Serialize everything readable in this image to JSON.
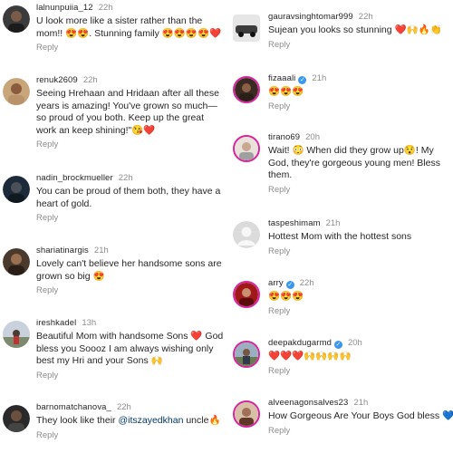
{
  "left_column": [
    {
      "username": "lalnunpuiia_12",
      "time": "22h",
      "verified": false,
      "text": "U look more like a sister rather than the mom!! 😍😍. Stunning family 😍😍😍😍❤️",
      "reply": "Reply",
      "avatar": "dark-portrait"
    },
    {
      "username": "renuk2609",
      "time": "22h",
      "verified": false,
      "text": "Seeing Hrehaan and Hridaan after all these years is amazing! You've grown so much—so proud of you both. Keep up the great work an keep shining!\"😘❤️",
      "reply": "Reply",
      "avatar": "woman-portrait"
    },
    {
      "username": "nadin_brockmueller",
      "time": "22h",
      "verified": false,
      "text": "You can be proud of them both, they have a heart of gold.",
      "reply": "Reply",
      "avatar": "dark-blue-portrait"
    },
    {
      "username": "shariatinargis",
      "time": "21h",
      "verified": false,
      "text": "Lovely can't believe her handsome sons are grown so big 😍",
      "reply": "Reply",
      "avatar": "brown-portrait"
    },
    {
      "username": "ireshkadel",
      "time": "13h",
      "verified": false,
      "text": "Beautiful Mom with handsome Sons ❤️ God bless you Soooz I am always wishing only best my Hri and your Sons 🙌",
      "reply": "Reply",
      "avatar": "outdoor-photo"
    },
    {
      "username": "barnomatchanova_",
      "time": "22h",
      "verified": false,
      "text_pre": "They look like their ",
      "mention": "@itszayedkhan",
      "text_post": " uncle🔥",
      "reply": "Reply",
      "avatar": "dark-portrait-2"
    }
  ],
  "right_column": [
    {
      "username": "gauravsinghtomar999",
      "time": "22h",
      "verified": false,
      "text": "Sujean you looks so stunning ❤️🙌🔥👏",
      "reply": "Reply",
      "avatar": "car-photo"
    },
    {
      "username": "fizaaali",
      "time": "21h",
      "verified": true,
      "text": "😍😍😍",
      "reply": "Reply",
      "avatar": "dark-portrait-3"
    },
    {
      "username": "tirano69",
      "time": "20h",
      "verified": false,
      "text": "Wait! 😳 When did they grow up😯! My God, they're gorgeous young men! Bless them.",
      "reply": "Reply",
      "avatar": "light-portrait"
    },
    {
      "username": "taspeshimam",
      "time": "21h",
      "verified": false,
      "text": "Hottest Mom with the hottest sons",
      "reply": "Reply",
      "avatar": "default-avatar"
    },
    {
      "username": "arry",
      "time": "22h",
      "verified": true,
      "text": "😍😍😍",
      "reply": "Reply",
      "avatar": "red-portrait"
    },
    {
      "username": "deepakdugarmd",
      "time": "20h",
      "verified": true,
      "text": "❤️❤️❤️🙌🙌🙌🙌",
      "reply": "Reply",
      "avatar": "outdoor-portrait"
    },
    {
      "username": "alveenagonsalves23",
      "time": "21h",
      "verified": false,
      "text": "How Gorgeous Are Your Boys God bless 💙🙌",
      "reply": "Reply",
      "avatar": "woman-portrait-2"
    }
  ],
  "colors": {
    "text": "#262626",
    "muted": "#8e8e8e",
    "verified": "#3897f0",
    "mention": "#00376b"
  }
}
